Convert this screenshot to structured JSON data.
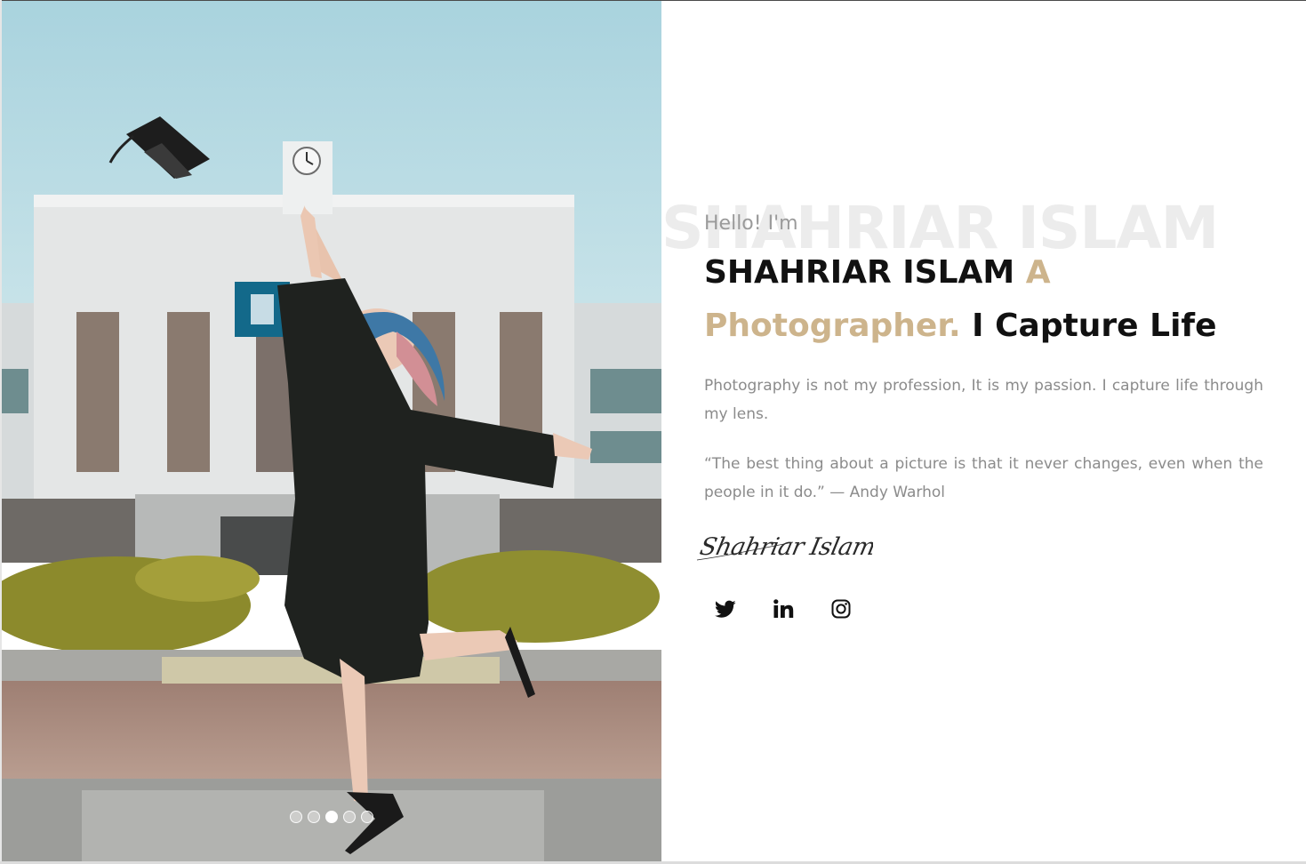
{
  "hero": {
    "image": "graduate-jumping-photo",
    "slider": {
      "count": 5,
      "active_index": 2
    }
  },
  "intro": {
    "background_name": "SHAHRIAR ISLAM",
    "greeting": "Hello! I'm",
    "name": "SHAHRIAR ISLAM",
    "accent_a": "A",
    "accent_role": "Photographer.",
    "tagline": "I Capture Life",
    "paragraph": "Photography is not my profession, It is my passion. I capture life through my lens.",
    "quote": "“The best thing about a picture is that it never changes, even when the people in it do.” — Andy Warhol",
    "signature": "Shahriar Islam"
  },
  "socials": [
    {
      "name": "twitter",
      "icon": "twitter-icon"
    },
    {
      "name": "linkedin",
      "icon": "linkedin-icon"
    },
    {
      "name": "instagram",
      "icon": "instagram-icon"
    }
  ],
  "colors": {
    "accent": "#cdb48c",
    "heading": "#111111",
    "body_text": "#8b8b8b",
    "watermark": "#ececec"
  }
}
